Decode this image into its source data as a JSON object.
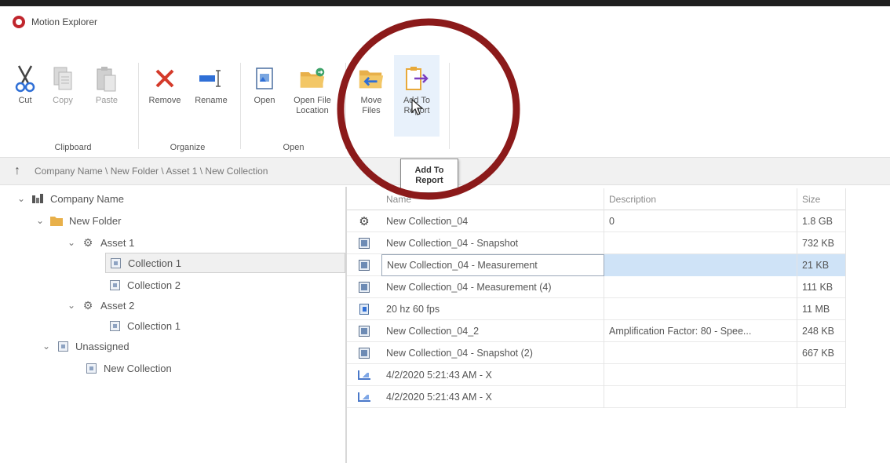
{
  "app": {
    "title": "Motion Explorer"
  },
  "ribbon": {
    "groups": [
      {
        "label": "Clipboard",
        "buttons": [
          {
            "label": "Cut"
          },
          {
            "label": "Copy"
          },
          {
            "label": "Paste"
          }
        ]
      },
      {
        "label": "Organize",
        "buttons": [
          {
            "label": "Remove"
          },
          {
            "label": "Rename"
          }
        ]
      },
      {
        "label": "Open",
        "buttons": [
          {
            "label": "Open"
          },
          {
            "label": "Open File\nLocation"
          }
        ]
      },
      {
        "label": "",
        "buttons": [
          {
            "label": "Move\nFiles"
          },
          {
            "label": "Add To\nReport"
          }
        ]
      }
    ],
    "tooltip": "Add To\nReport"
  },
  "address": {
    "path": "Company Name \\ New Folder \\ Asset 1 \\ New Collection"
  },
  "tree": [
    {
      "label": "Company Name"
    },
    {
      "label": "New Folder"
    },
    {
      "label": "Asset 1"
    },
    {
      "label": "Collection 1"
    },
    {
      "label": "Collection 2"
    },
    {
      "label": "Asset 2"
    },
    {
      "label": "Collection 1"
    },
    {
      "label": "Unassigned"
    },
    {
      "label": "New Collection"
    }
  ],
  "table": {
    "columns": {
      "name": "Name",
      "description": "Description",
      "size": "Size"
    },
    "rows": [
      {
        "name": "New Collection_04",
        "description": "0",
        "size": "1.8 GB"
      },
      {
        "name": "New Collection_04 - Snapshot",
        "description": "",
        "size": "732 KB"
      },
      {
        "name": "New Collection_04 - Measurement",
        "description": "",
        "size": "21 KB"
      },
      {
        "name": "New Collection_04 - Measurement (4)",
        "description": "",
        "size": "111 KB"
      },
      {
        "name": "20 hz 60 fps",
        "description": "",
        "size": "11 MB"
      },
      {
        "name": "New Collection_04_2",
        "description": "Amplification Factor: 80 - Spee...",
        "size": "248 KB"
      },
      {
        "name": "New Collection_04 - Snapshot (2)",
        "description": "",
        "size": "667 KB"
      },
      {
        "name": "4/2/2020 5:21:43 AM - X",
        "description": "",
        "size": ""
      },
      {
        "name": "4/2/2020 5:21:43 AM - X",
        "description": "",
        "size": ""
      }
    ]
  },
  "colors": {
    "annotation": "#8b1a1a",
    "selection": "#cfe3f7",
    "accent": "#c0262d"
  }
}
